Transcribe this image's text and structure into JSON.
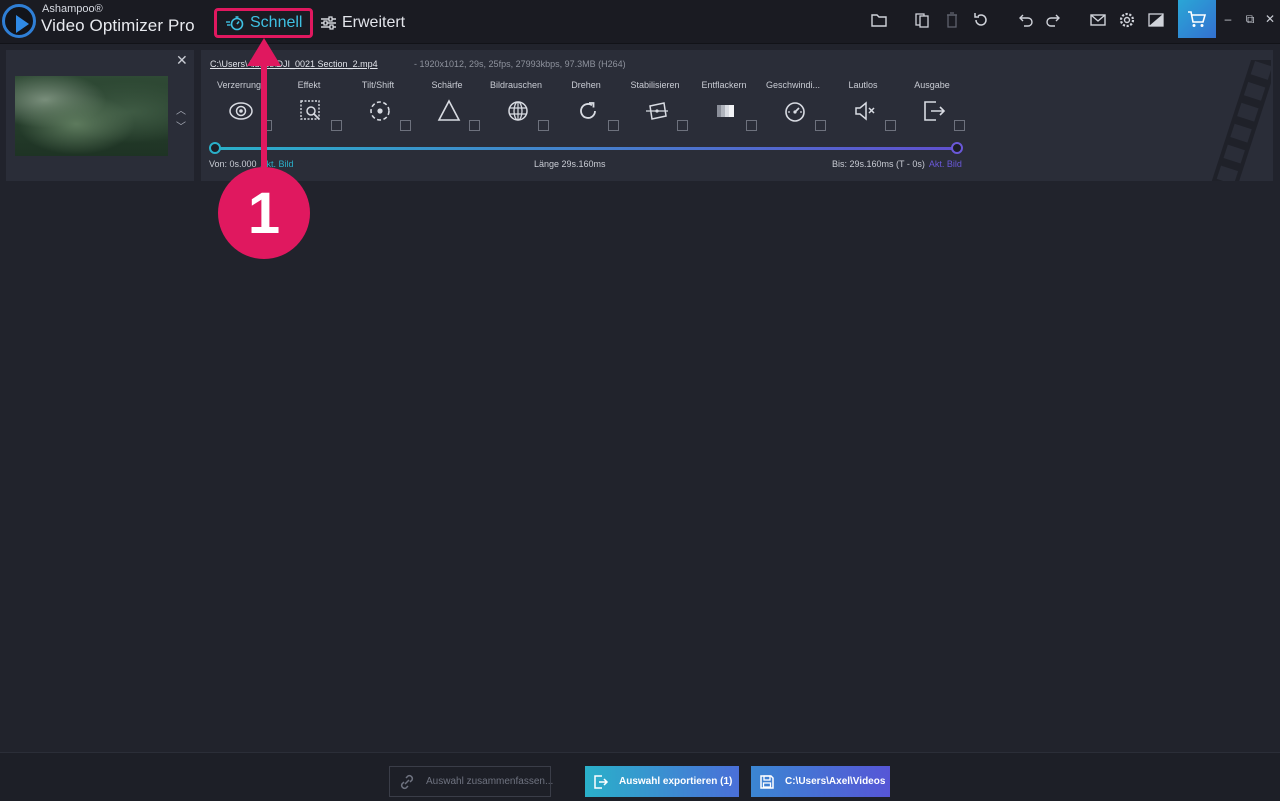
{
  "app": {
    "brand_small": "Ashampoo®",
    "brand_name": "Video Optimizer Pro"
  },
  "modes": {
    "schnell": "Schnell",
    "erweitert": "Erweitert"
  },
  "toolbar": {
    "icons": [
      "folder-icon",
      "copy-icon",
      "trash-icon",
      "reset-icon",
      "undo-icon",
      "redo-icon",
      "mail-icon",
      "gear-icon",
      "theme-icon",
      "cart-icon"
    ]
  },
  "window_controls": {
    "minimize": "–",
    "restore": "⧉",
    "close": "✕"
  },
  "clip": {
    "path": "C:\\Users\\...\\Videos\\DJI_0021 Section_2.mp4",
    "path_display": "C:\\Users\\   \\ideos\\DJI_0021 Section_2.mp4",
    "meta": "-   1920x1012, 29s, 25fps, 27993kbps, 97.3MB (H264)",
    "tools": [
      {
        "label": "Verzerrung",
        "icon": "eye-icon"
      },
      {
        "label": "Effekt",
        "icon": "effect-icon"
      },
      {
        "label": "Tilt/Shift",
        "icon": "tiltshift-icon"
      },
      {
        "label": "Schärfe",
        "icon": "triangle-icon"
      },
      {
        "label": "Bildrauschen",
        "icon": "globe-icon"
      },
      {
        "label": "Drehen",
        "icon": "rotate-icon"
      },
      {
        "label": "Stabilisieren",
        "icon": "stabilize-icon"
      },
      {
        "label": "Entflackern",
        "icon": "deflicker-icon"
      },
      {
        "label": "Geschwindi...",
        "icon": "speedometer-icon"
      },
      {
        "label": "Lautlos",
        "icon": "mute-icon"
      },
      {
        "label": "Ausgabe",
        "icon": "output-icon"
      }
    ],
    "from_label": "Von: 0s.000",
    "from_link": "Akt. Bild",
    "length_label": "Länge 29s.160ms",
    "to_label": "Bis: 29s.160ms (T - 0s)",
    "to_link": "Akt. Bild"
  },
  "annotation": {
    "number": "1",
    "color": "#e0185f"
  },
  "footer": {
    "merge_label": "Auswahl zusammenfassen...",
    "export_label": "Auswahl exportieren (1)",
    "folder_label": "C:\\Users\\Axel\\Videos"
  }
}
